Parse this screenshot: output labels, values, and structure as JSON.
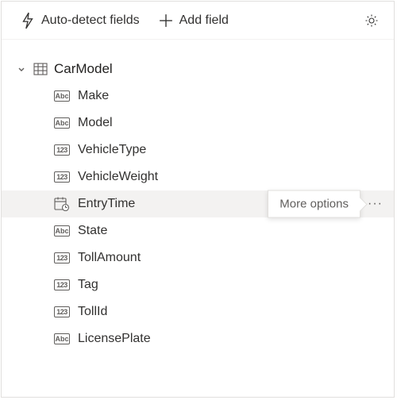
{
  "toolbar": {
    "autodetect_label": "Auto-detect fields",
    "addfield_label": "Add field"
  },
  "table": {
    "name": "CarModel",
    "expanded": true
  },
  "fields": [
    {
      "name": "Make",
      "type": "Abc",
      "hover": false
    },
    {
      "name": "Model",
      "type": "Abc",
      "hover": false
    },
    {
      "name": "VehicleType",
      "type": "123",
      "hover": false
    },
    {
      "name": "VehicleWeight",
      "type": "123",
      "hover": false
    },
    {
      "name": "EntryTime",
      "type": "date",
      "hover": true
    },
    {
      "name": "State",
      "type": "Abc",
      "hover": false
    },
    {
      "name": "TollAmount",
      "type": "123",
      "hover": false
    },
    {
      "name": "Tag",
      "type": "123",
      "hover": false
    },
    {
      "name": "TollId",
      "type": "123",
      "hover": false
    },
    {
      "name": "LicensePlate",
      "type": "Abc",
      "hover": false
    }
  ],
  "tooltip": {
    "more_options": "More options"
  }
}
